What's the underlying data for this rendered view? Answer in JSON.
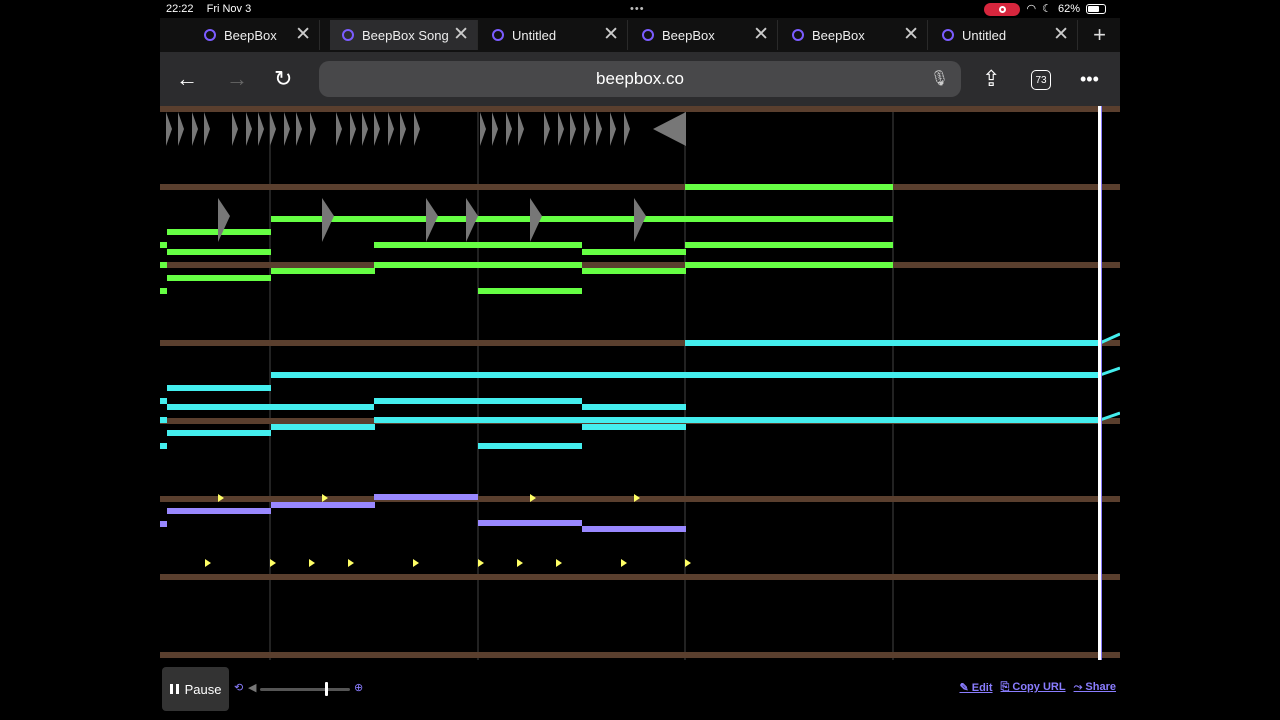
{
  "status_bar": {
    "time": "22:22",
    "date": "Fri Nov 3",
    "battery": "62%"
  },
  "tabs": [
    {
      "title": "BeepBox",
      "active": false
    },
    {
      "title": "BeepBox Song",
      "active": true
    },
    {
      "title": "Untitled",
      "active": false
    },
    {
      "title": "BeepBox",
      "active": false
    },
    {
      "title": "BeepBox",
      "active": false
    },
    {
      "title": "Untitled",
      "active": false
    }
  ],
  "toolbar": {
    "url": "beepbox.co",
    "tab_count": "73"
  },
  "player": {
    "pause_label": "Pause",
    "volume": 0.72,
    "links": {
      "edit": "✎ Edit",
      "copy_url": "⎘ Copy URL",
      "share": "⤳ Share"
    }
  },
  "colors": {
    "pitch1": "#66ff44",
    "pitch2": "#44eeee",
    "pitch3": "#9988ff",
    "drum": "#ffff66",
    "separator": "#5a3f2e",
    "playhead": "#ffffff"
  }
}
